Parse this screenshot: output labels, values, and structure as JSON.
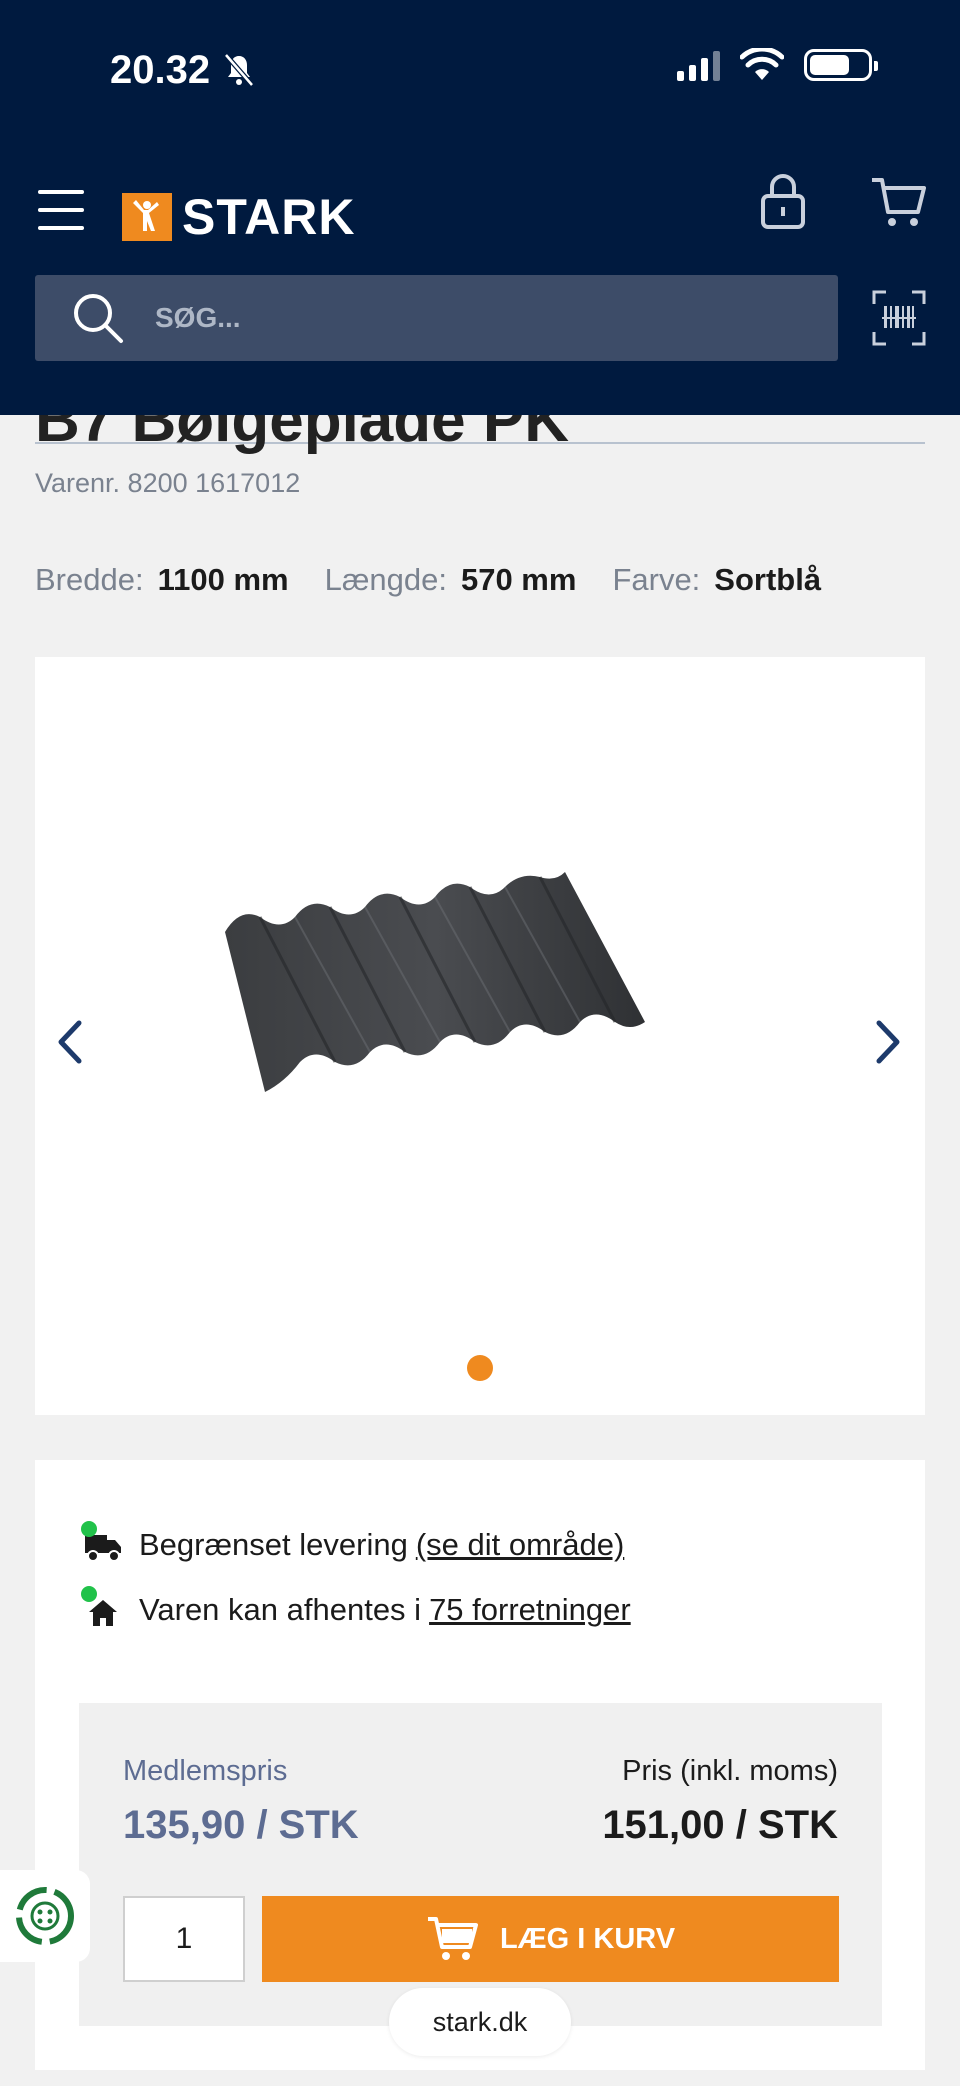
{
  "status_bar": {
    "time": "20.32"
  },
  "header": {
    "brand": "STARK",
    "search_placeholder": "SØG..."
  },
  "product": {
    "title_cropped": "B7 Bølgeplade PK",
    "sku": "Varenr. 8200 1617012",
    "specs": [
      {
        "label": "Bredde:",
        "value": "1100 mm"
      },
      {
        "label": "Længde:",
        "value": "570 mm"
      },
      {
        "label": "Farve:",
        "value": "Sortblå"
      }
    ]
  },
  "availability": {
    "delivery_text": "Begrænset levering",
    "delivery_link": "(se dit område)",
    "pickup_text": "Varen kan afhentes i",
    "pickup_link": "75 forretninger"
  },
  "pricing": {
    "member_label": "Medlemspris",
    "member_price": "135,90 / STK",
    "price_label": "Pris (inkl. moms)",
    "price": "151,00 / STK",
    "quantity": "1",
    "add_button": "LÆG I KURV"
  },
  "browser": {
    "domain": "stark.dk"
  },
  "colors": {
    "header_bg": "#001a3f",
    "accent": "#ef8a1f",
    "member_price": "#5d6c92",
    "available": "#21c24a"
  },
  "icons": [
    "bell-off-icon",
    "signal-icon",
    "wifi-icon",
    "battery-icon",
    "menu-icon",
    "stark-logo-icon",
    "lock-icon",
    "cart-icon",
    "search-icon",
    "barcode-scan-icon",
    "chevron-left-icon",
    "chevron-right-icon",
    "truck-icon",
    "home-icon",
    "recycle-icon"
  ]
}
